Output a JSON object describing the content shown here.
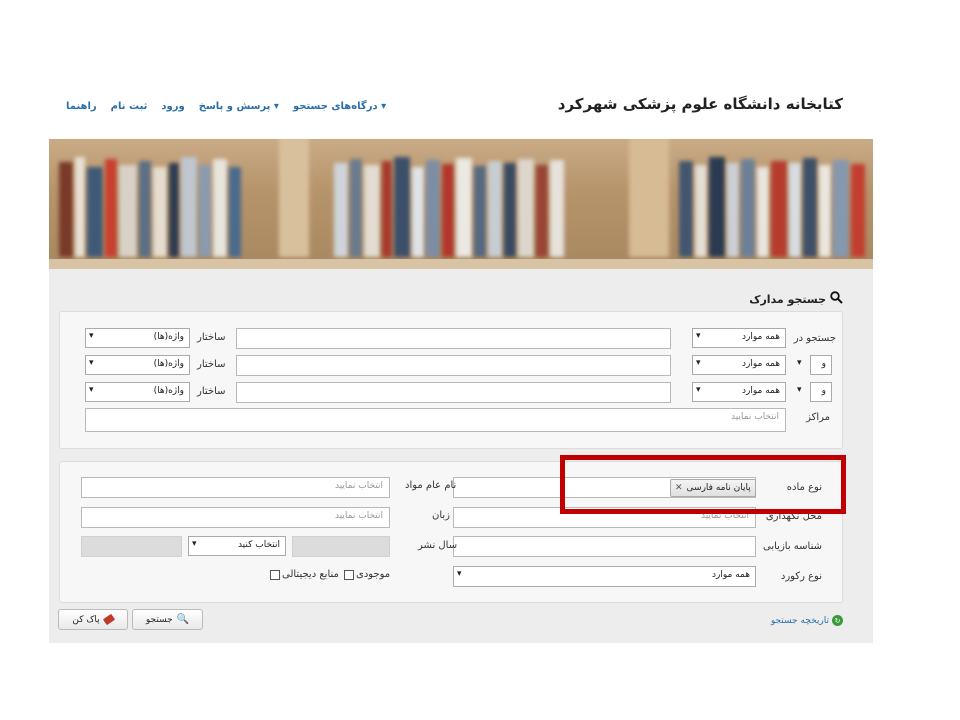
{
  "header": {
    "site_title": "کتابخانه دانشگاه علوم پزشکی شهرکرد",
    "nav": [
      {
        "label": "راهنما"
      },
      {
        "label": "ثبت نام"
      },
      {
        "label": "ورود"
      },
      {
        "label": "پرسش و پاسخ ▾"
      },
      {
        "label": "درگاه‌های جستجو ▾"
      }
    ]
  },
  "search": {
    "title": "جستجو مدارک",
    "row1": {
      "label": "جستجو در",
      "field": "همه موارد",
      "structure_label": "ساختار",
      "structure": "واژه(ها)"
    },
    "row2": {
      "operator": "و",
      "field": "همه موارد",
      "structure_label": "ساختار",
      "structure": "واژه(ها)"
    },
    "row3": {
      "operator": "و",
      "field": "همه موارد",
      "structure_label": "ساختار",
      "structure": "واژه(ها)"
    },
    "centers": {
      "label": "مراکز",
      "placeholder": "انتخاب نمایید"
    }
  },
  "filters": {
    "material_type": {
      "label": "نوع ماده",
      "chip": "پایان نامه فارسی"
    },
    "material_name": {
      "label": "نام عام مواد",
      "placeholder": "انتخاب نمایید"
    },
    "location": {
      "label": "محل نگهداری",
      "placeholder": "انتخاب نمایید"
    },
    "language": {
      "label": "زبان",
      "placeholder": "انتخاب نمایید"
    },
    "call_number": {
      "label": "شناسه بازیابی"
    },
    "pub_year": {
      "label": "سال نشر",
      "select": "انتخاب کنید"
    },
    "record_type": {
      "label": "نوع رکورد",
      "value": "همه موارد"
    },
    "available": {
      "label": "موجودی"
    },
    "digital": {
      "label": "منابع دیجیتالی"
    }
  },
  "actions": {
    "history": "تاریخچه جستجو",
    "search_btn": "جستجو",
    "clear_btn": "پاک کن"
  },
  "colors": {
    "highlight": "#c00000",
    "link": "#2a6fa8"
  }
}
